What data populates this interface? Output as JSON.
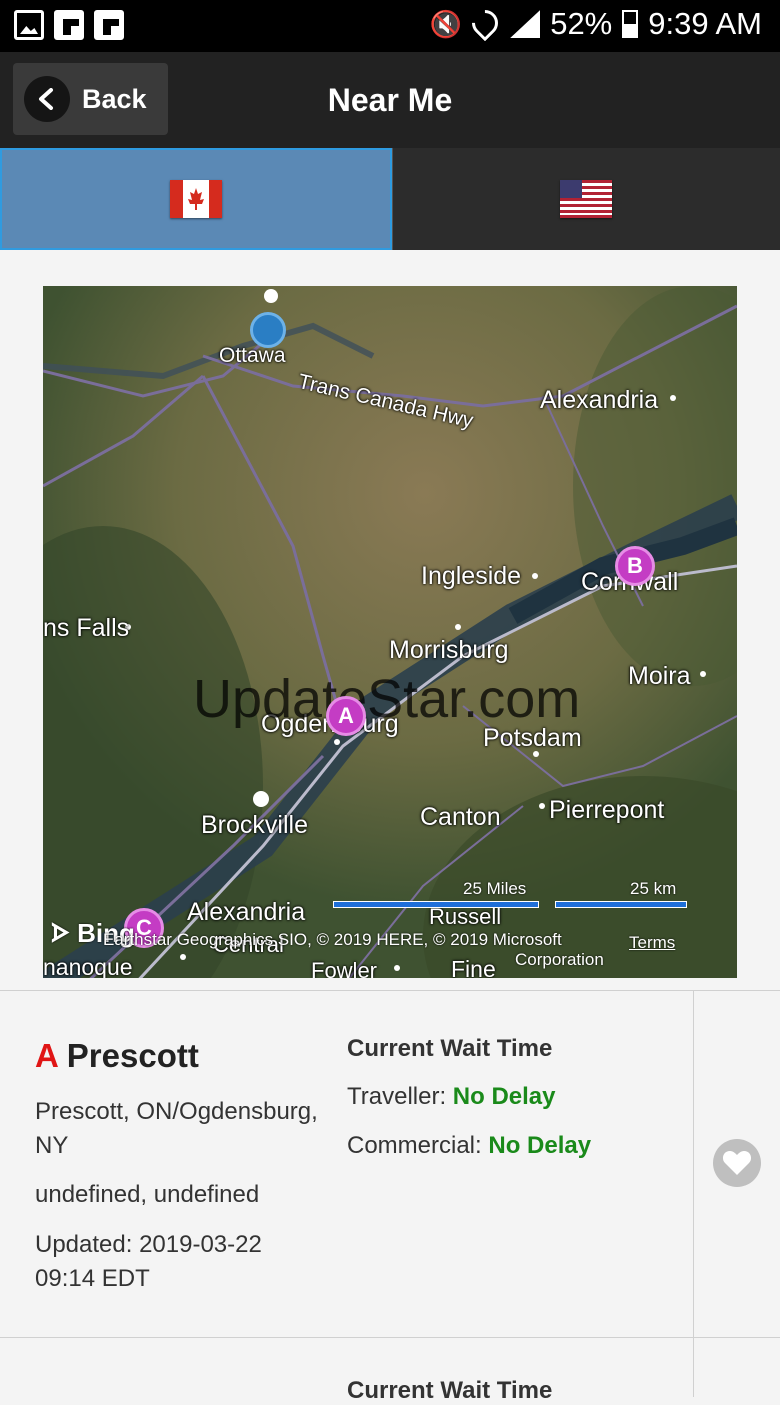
{
  "status_bar": {
    "battery": "52%",
    "time": "9:39 AM"
  },
  "app_bar": {
    "back_label": "Back",
    "title": "Near Me"
  },
  "tabs": [
    {
      "country": "Canada",
      "icon": "canada-flag-icon",
      "active": true
    },
    {
      "country": "United States",
      "icon": "usa-flag-icon",
      "active": false
    }
  ],
  "map": {
    "watermark": "UpdateStar.com",
    "labels": {
      "ottawa": "Ottawa",
      "highway": "Trans Canada Hwy",
      "alexandria_ne": "Alexandria",
      "ingleside": "Ingleside",
      "cornwall": "Cornwall",
      "falls": "ns Falls",
      "morrisburg": "Morrisburg",
      "moira": "Moira",
      "ogdensburg": "Ogdensburg",
      "potsdam": "Potsdam",
      "brockville": "Brockville",
      "canton": "Canton",
      "pierrepont": "Pierrepont",
      "alexandria_sw": "Alexandria",
      "russell": "Russell",
      "ganoque": "nanoque",
      "fowler": "Fowler",
      "fine": "Fine",
      "central": "Central"
    },
    "pins": [
      "A",
      "B",
      "C"
    ],
    "scale_miles": "25 Miles",
    "scale_km": "25 km",
    "bing_label": "Bing",
    "attribution_line1": "Earthstar Geographics SIO, © 2019 HERE, © 2019 Microsoft",
    "attribution_line2": "Corporation",
    "terms": "Terms"
  },
  "result": {
    "letter": "A",
    "name": "Prescott",
    "location_line1": "Prescott, ON/Ogdensburg,",
    "location_line2": "NY",
    "coords": "undefined, undefined",
    "updated_line1": "Updated: 2019-03-22",
    "updated_line2": "09:14 EDT",
    "wait_heading": "Current Wait Time",
    "traveller_label": "Traveller: ",
    "traveller_value": "No Delay",
    "commercial_label": "Commercial: ",
    "commercial_value": "No Delay"
  },
  "next_result": {
    "wait_heading": "Current Wait Time"
  },
  "colors": {
    "active_tab": "#5b89b5",
    "delay_green": "#1a8a1a",
    "marker_letter": "#e01515",
    "pin": "#c43cc4"
  }
}
